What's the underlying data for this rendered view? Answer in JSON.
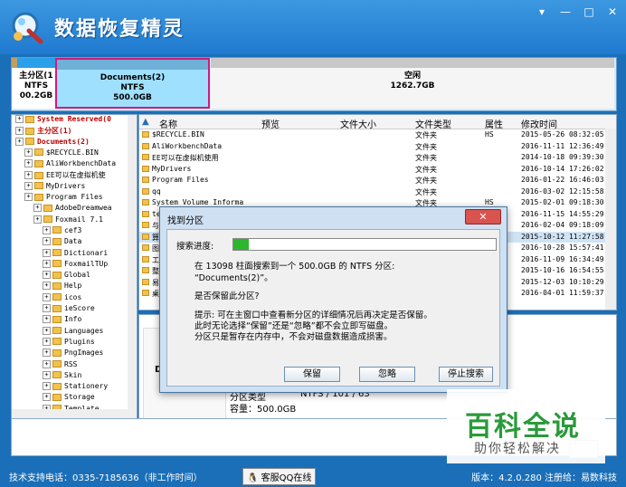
{
  "app": {
    "title": "数据恢复精灵"
  },
  "window_controls": [
    "▾",
    "—",
    "□",
    "✕"
  ],
  "disk": {
    "partitions": [
      {
        "name": "",
        "fs": "",
        "size": ""
      },
      {
        "name": "主分区(1",
        "fs": "NTFS",
        "size": "00.2GB"
      },
      {
        "name": "Documents(2)",
        "fs": "NTFS",
        "size": "500.0GB"
      },
      {
        "name": "空闲",
        "fs": "",
        "size": "1262.7GB"
      }
    ]
  },
  "tree": {
    "rows": [
      {
        "label": "System Reserved(0",
        "indent": 1,
        "red": true
      },
      {
        "label": "主分区(1)",
        "indent": 1,
        "red": true
      },
      {
        "label": "Documents(2)",
        "indent": 1,
        "red": true
      },
      {
        "label": "$RECYCLE.BIN",
        "indent": 2,
        "red": false
      },
      {
        "label": "AliWorkbenchData",
        "indent": 2,
        "red": false
      },
      {
        "label": "EE可以在虚拟机使",
        "indent": 2,
        "red": false
      },
      {
        "label": "MyDrivers",
        "indent": 2,
        "red": false
      },
      {
        "label": "Program Files",
        "indent": 2,
        "red": false
      },
      {
        "label": "AdobeDreamwea",
        "indent": 3,
        "red": false
      },
      {
        "label": "Foxmail 7.1",
        "indent": 3,
        "red": false
      },
      {
        "label": "cef3",
        "indent": 4,
        "red": false
      },
      {
        "label": "Data",
        "indent": 4,
        "red": false
      },
      {
        "label": "Dictionari",
        "indent": 4,
        "red": false
      },
      {
        "label": "FoxmailTUp",
        "indent": 4,
        "red": false
      },
      {
        "label": "Global",
        "indent": 4,
        "red": false
      },
      {
        "label": "Help",
        "indent": 4,
        "red": false
      },
      {
        "label": "icos",
        "indent": 4,
        "red": false
      },
      {
        "label": "ieScore",
        "indent": 4,
        "red": false
      },
      {
        "label": "Info",
        "indent": 4,
        "red": false
      },
      {
        "label": "Languages",
        "indent": 4,
        "red": false
      },
      {
        "label": "Plugins",
        "indent": 4,
        "red": false
      },
      {
        "label": "PngImages",
        "indent": 4,
        "red": false
      },
      {
        "label": "RSS",
        "indent": 4,
        "red": false
      },
      {
        "label": "Skin",
        "indent": 4,
        "red": false
      },
      {
        "label": "Stationery",
        "indent": 4,
        "red": false
      },
      {
        "label": "Storage",
        "indent": 4,
        "red": false
      },
      {
        "label": "Template",
        "indent": 4,
        "red": false
      }
    ]
  },
  "files": {
    "columns": [
      "名称",
      "预览",
      "文件大小",
      "文件类型",
      "属性",
      "修改时间"
    ],
    "rows": [
      {
        "name": "$RECYCLE.BIN",
        "type": "文件夹",
        "attr": "HS",
        "time": "2015-05-26 08:32:05"
      },
      {
        "name": "AliWorkbenchData",
        "type": "文件夹",
        "attr": "",
        "time": "2016-11-11 12:36:49"
      },
      {
        "name": "EE可以在虚拟机使用",
        "type": "文件夹",
        "attr": "",
        "time": "2014-10-18 09:39:30"
      },
      {
        "name": "MyDrivers",
        "type": "文件夹",
        "attr": "",
        "time": "2016-10-14 17:26:02"
      },
      {
        "name": "Program Files",
        "type": "文件夹",
        "attr": "",
        "time": "2016-01-22 16:46:03"
      },
      {
        "name": "qq",
        "type": "文件夹",
        "attr": "",
        "time": "2016-03-02 12:15:58"
      },
      {
        "name": "System Volume Informa",
        "type": "文件夹",
        "attr": "HS",
        "time": "2015-02-01 09:18:30"
      },
      {
        "name": "te",
        "type": "文件夹",
        "attr": "",
        "time": "2016-11-15 14:55:29"
      },
      {
        "name": "与",
        "type": "文件夹",
        "attr": "",
        "time": "2016-02-04 09:18:09"
      },
      {
        "name": "算",
        "type": "文件夹",
        "attr": "",
        "time": "2015-10-12 11:27:58"
      },
      {
        "name": "图",
        "type": "文件夹",
        "attr": "",
        "time": "2016-10-28 15:57:41"
      },
      {
        "name": "工",
        "type": "文件夹",
        "attr": "",
        "time": "2016-11-09 16:34:49"
      },
      {
        "name": "整",
        "type": "文件夹",
        "attr": "",
        "time": "2015-10-16 16:54:55"
      },
      {
        "name": "易",
        "type": "文件夹",
        "attr": "",
        "time": "2015-12-03 10:10:29"
      },
      {
        "name": "桌",
        "type": "文件夹",
        "attr": "",
        "time": "2016-04-01 11:59:37"
      }
    ]
  },
  "info": {
    "label_d": "D",
    "line1": "分区类型",
    "line1_value": "NTFS  /  101  /  63",
    "line2": "容量：500.0GB"
  },
  "dialog": {
    "title": "找到分区",
    "close": "✕",
    "progress_label": "搜索进度:",
    "progress": 0.06,
    "msg1": "在 13098 柱面搜索到一个 500.0GB 的 NTFS 分区:",
    "msg2": "“Documents(2)”。",
    "question": "是否保留此分区?",
    "hint1": "提示: 可在主窗口中查看新分区的详细情况后再决定是否保留。",
    "hint2": "此时无论选择“保留”还是“忽略”都不会立即写磁盘。",
    "hint3": "分区只是暂存在内存中，不会对磁盘数据造成损害。",
    "btn_keep": "保留",
    "btn_ignore": "忽略",
    "btn_stop": "停止搜索"
  },
  "status": {
    "support": "技术支持电话：0335-7185636（非工作时间）",
    "qq": "客服QQ在线",
    "version": "版本：4.2.0.280   注册给：易数科技"
  },
  "watermark": {
    "title": "百科全说",
    "sub": "助你轻松解决"
  }
}
